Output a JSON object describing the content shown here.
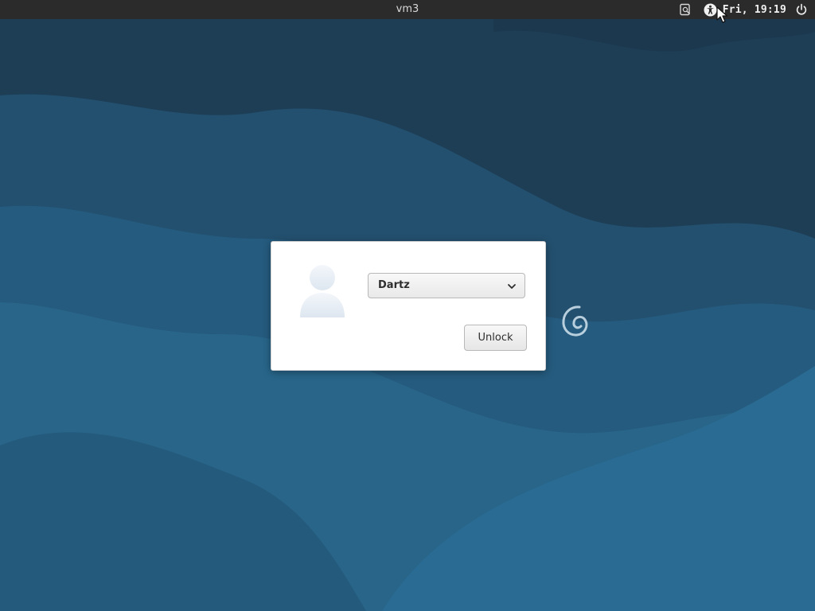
{
  "topbar": {
    "hostname": "vm3",
    "clock": "Fri, 19:19",
    "icons": {
      "keyboard": "keyboard-layout-icon",
      "accessibility": "accessibility-icon",
      "power": "power-icon"
    }
  },
  "unlock_dialog": {
    "avatar_icon": "user-avatar-icon",
    "selected_user": "Dartz",
    "unlock_label": "Unlock"
  },
  "desktop": {
    "logo_icon": "debian-swirl-icon"
  },
  "colors": {
    "topbar_bg": "#2b2b2b",
    "wallpaper_dark": "#1d3f58",
    "wallpaper_light": "#2a6a94",
    "dialog_bg": "#ffffff"
  }
}
